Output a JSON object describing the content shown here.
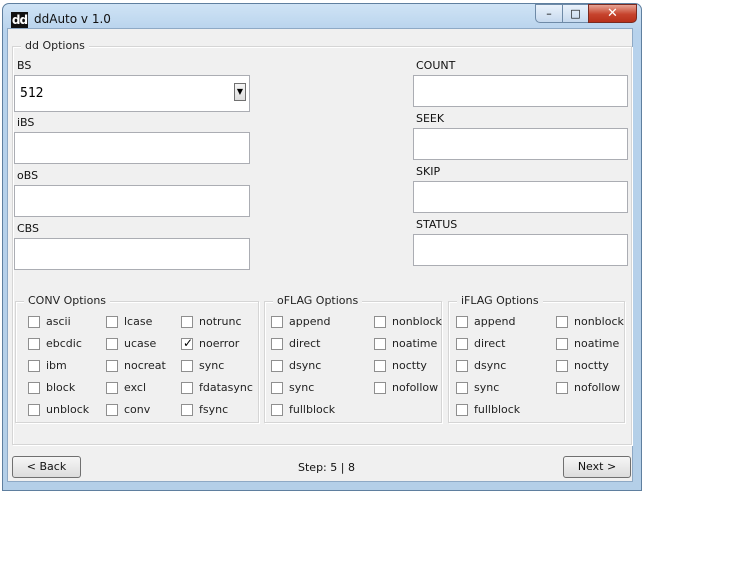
{
  "window": {
    "title": "ddAuto v 1.0",
    "icon_text": "dd",
    "icon": "dd-app-icon",
    "controls": {
      "minimize": "–",
      "maximize": "□",
      "close": "✕"
    }
  },
  "dd_options": {
    "legend": "dd Options",
    "bs": {
      "label": "BS",
      "value": "512"
    },
    "ibs": {
      "label": "iBS",
      "value": ""
    },
    "obs": {
      "label": "oBS",
      "value": ""
    },
    "cbs": {
      "label": "CBS",
      "value": ""
    },
    "count": {
      "label": "COUNT",
      "value": ""
    },
    "seek": {
      "label": "SEEK",
      "value": ""
    },
    "skip": {
      "label": "SKIP",
      "value": ""
    },
    "status": {
      "label": "STATUS",
      "value": ""
    }
  },
  "conv": {
    "legend": "CONV Options",
    "items": [
      {
        "label": "ascii",
        "checked": false
      },
      {
        "label": "lcase",
        "checked": false
      },
      {
        "label": "notrunc",
        "checked": false
      },
      {
        "label": "ebcdic",
        "checked": false
      },
      {
        "label": "ucase",
        "checked": false
      },
      {
        "label": "noerror",
        "checked": true
      },
      {
        "label": "ibm",
        "checked": false
      },
      {
        "label": "nocreat",
        "checked": false
      },
      {
        "label": "sync",
        "checked": false
      },
      {
        "label": "block",
        "checked": false
      },
      {
        "label": "excl",
        "checked": false
      },
      {
        "label": "fdatasync",
        "checked": false
      },
      {
        "label": "unblock",
        "checked": false
      },
      {
        "label": "conv",
        "checked": false
      },
      {
        "label": "fsync",
        "checked": false
      }
    ]
  },
  "oflag": {
    "legend": "oFLAG Options",
    "items": [
      {
        "label": "append",
        "checked": false
      },
      {
        "label": "nonblock",
        "checked": false
      },
      {
        "label": "direct",
        "checked": false
      },
      {
        "label": "noatime",
        "checked": false
      },
      {
        "label": "dsync",
        "checked": false
      },
      {
        "label": "noctty",
        "checked": false
      },
      {
        "label": "sync",
        "checked": false
      },
      {
        "label": "nofollow",
        "checked": false
      },
      {
        "label": "fullblock",
        "checked": false
      }
    ]
  },
  "iflag": {
    "legend": "iFLAG Options",
    "items": [
      {
        "label": "append",
        "checked": false
      },
      {
        "label": "nonblock",
        "checked": false
      },
      {
        "label": "direct",
        "checked": false
      },
      {
        "label": "noatime",
        "checked": false
      },
      {
        "label": "dsync",
        "checked": false
      },
      {
        "label": "noctty",
        "checked": false
      },
      {
        "label": "sync",
        "checked": false
      },
      {
        "label": "nofollow",
        "checked": false
      },
      {
        "label": "fullblock",
        "checked": false
      }
    ]
  },
  "footer": {
    "back": "< Back",
    "step": "Step: 5 | 8",
    "next": "Next >"
  }
}
